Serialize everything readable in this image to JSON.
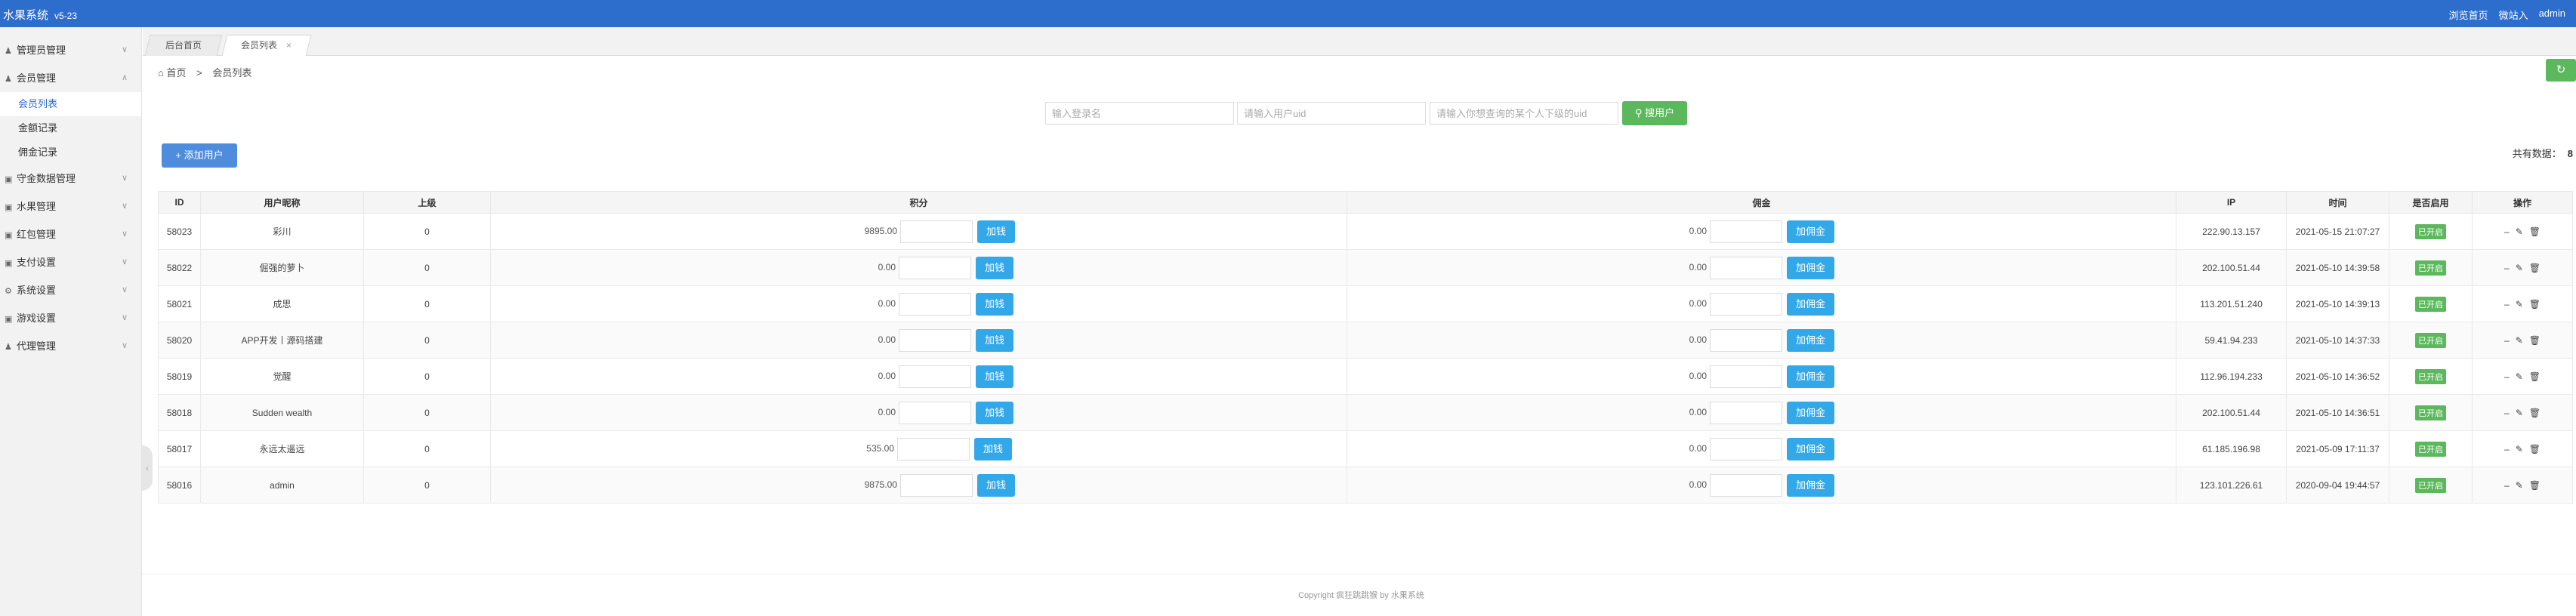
{
  "header": {
    "title": "水果系统",
    "version": "v5-23",
    "links": [
      "浏览首页",
      "微站入",
      "admin"
    ]
  },
  "sidebar": {
    "items": [
      {
        "label": "管理员管理",
        "icon": "user-icon",
        "expanded": false
      },
      {
        "label": "会员管理",
        "icon": "users-icon",
        "expanded": true,
        "children": [
          "会员列表",
          "金额记录",
          "佣金记录"
        ]
      },
      {
        "label": "守金数据管理",
        "icon": "database-icon",
        "expanded": false
      },
      {
        "label": "水果管理",
        "icon": "apple-icon",
        "expanded": false
      },
      {
        "label": "红包管理",
        "icon": "gift-icon",
        "expanded": false
      },
      {
        "label": "支付设置",
        "icon": "card-icon",
        "expanded": false
      },
      {
        "label": "系统设置",
        "icon": "gear-icon",
        "expanded": false
      },
      {
        "label": "游戏设置",
        "icon": "gamepad-icon",
        "expanded": false
      },
      {
        "label": "代理管理",
        "icon": "agent-icon",
        "expanded": false
      }
    ],
    "active_sub": "会员列表"
  },
  "tabs": [
    {
      "label": "后台首页",
      "active": false
    },
    {
      "label": "会员列表",
      "active": true,
      "close": "×"
    }
  ],
  "breadcrumb": {
    "home": "首页",
    "separator": ">",
    "current": "会员列表"
  },
  "search": {
    "username_placeholder": "输入登录名",
    "uid_placeholder": "请输入用户uid",
    "sub_uid_placeholder": "请输入你想查询的某个人下级的uid",
    "button_label": "搜用户"
  },
  "toolbar": {
    "add_label": "添加用户",
    "total_label": "共有数据：",
    "total_count": "8"
  },
  "table": {
    "columns": [
      "ID",
      "用户昵称",
      "上级",
      "积分",
      "佣金",
      "IP",
      "时间",
      "是否启用",
      "操作"
    ],
    "score_button": "加钱",
    "commission_button": "加佣金",
    "enabled_label": "已开启",
    "rows": [
      {
        "id": "58023",
        "nickname": "彩川",
        "parent": "0",
        "score": "9895.00",
        "commission": "0.00",
        "ip": "222.90.13.157",
        "time": "2021-05-15 21:07:27"
      },
      {
        "id": "58022",
        "nickname": "倔强的萝卜",
        "parent": "0",
        "score": "0.00",
        "commission": "0.00",
        "ip": "202.100.51.44",
        "time": "2021-05-10 14:39:58"
      },
      {
        "id": "58021",
        "nickname": "成思",
        "parent": "0",
        "score": "0.00",
        "commission": "0.00",
        "ip": "113.201.51.240",
        "time": "2021-05-10 14:39:13"
      },
      {
        "id": "58020",
        "nickname": "APP开发丨源码搭建",
        "parent": "0",
        "score": "0.00",
        "commission": "0.00",
        "ip": "59.41.94.233",
        "time": "2021-05-10 14:37:33"
      },
      {
        "id": "58019",
        "nickname": "觉醒",
        "parent": "0",
        "score": "0.00",
        "commission": "0.00",
        "ip": "112.96.194.233",
        "time": "2021-05-10 14:36:52"
      },
      {
        "id": "58018",
        "nickname": "Sudden wealth",
        "parent": "0",
        "score": "0.00",
        "commission": "0.00",
        "ip": "202.100.51.44",
        "time": "2021-05-10 14:36:51"
      },
      {
        "id": "58017",
        "nickname": "永远太遥远",
        "parent": "0",
        "score": "535.00",
        "commission": "0.00",
        "ip": "61.185.196.98",
        "time": "2021-05-09 17:11:37"
      },
      {
        "id": "58016",
        "nickname": "admin",
        "parent": "0",
        "score": "9875.00",
        "commission": "0.00",
        "ip": "123.101.226.61",
        "time": "2020-09-04 19:44:57"
      }
    ]
  },
  "footer": {
    "text": "Copyright 疯狂跳跳猴 by 水果系统"
  },
  "colors": {
    "header": "#2d6dcb",
    "primary_button": "#4e8dde",
    "success": "#5cb85c",
    "info": "#33a8e8"
  }
}
